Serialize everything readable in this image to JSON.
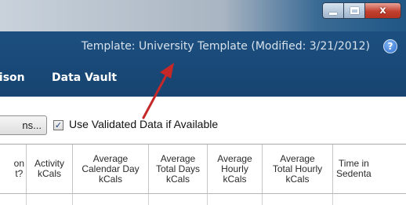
{
  "window": {
    "minimize_glyph": "",
    "maximize_glyph": "",
    "close_glyph": "x"
  },
  "header": {
    "template_info": "Template: University Template (Modified: 3/21/2012)",
    "help_glyph": "?"
  },
  "menu": {
    "items": [
      "rison",
      "Data Vault"
    ]
  },
  "options": {
    "button_label": "ns...",
    "checkbox_checked": true,
    "checkbox_label": "Use Validated Data if Available"
  },
  "table": {
    "columns": [
      "on\nt?",
      "Activity\nkCals",
      "Average\nCalendar Day\nkCals",
      "Average\nTotal Days\nkCals",
      "Average\nHourly\nkCals",
      "Average\nTotal Hourly\nkCals",
      "Time in\nSedenta"
    ]
  },
  "colors": {
    "header_blue": "#1c4f80",
    "annotation_arrow": "#c62828"
  }
}
